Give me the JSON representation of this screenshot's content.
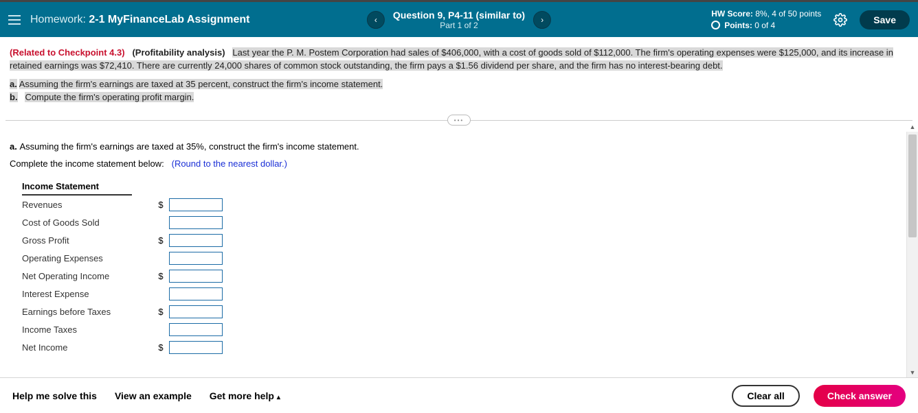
{
  "header": {
    "homework_prefix": "Homework: ",
    "homework_name": "2-1 MyFinanceLab Assignment",
    "question_title": "Question 9, P4-11 (similar to)",
    "question_part": "Part 1 of 2",
    "hw_score_label": "HW Score:",
    "hw_score_value": " 8%, 4 of 50 points",
    "points_label": "Points:",
    "points_value": " 0 of 4",
    "save_label": "Save"
  },
  "problem": {
    "checkpoint": "(Related to Checkpoint 4.3)",
    "topic": "(Profitability analysis)",
    "body1": "Last year the P. M. Postem Corporation had sales of ",
    "sales": "$406,000",
    "body2": ", with a cost of goods sold of ",
    "cogs": "$112,000",
    "body3": ". The firm's operating expenses were ",
    "opex": "$125,000",
    "body4": ", and its increase in retained earnings was ",
    "retained": "$72,410",
    "body5": ". There are currently ",
    "shares": "24,000",
    "body6": " shares of common stock outstanding, the firm pays a ",
    "dividend": "$1.56",
    "body7": " dividend per share, and the firm has no interest-bearing debt.",
    "part_a_prefix": "a.",
    "part_a": "Assuming the firm's earnings are taxed at ",
    "taxrate": "35",
    "part_a_suffix": " percent, construct the firm's income statement.",
    "part_b_prefix": "b.",
    "part_b": "Compute the firm's operating profit margin."
  },
  "work": {
    "subq_prefix": "a.",
    "subq": "Assuming the firm's earnings are taxed at 35%, construct the firm's income statement.",
    "complete_line": "Complete the income statement below:",
    "round_note": "(Round to the nearest dollar.)",
    "table_header": "Income Statement",
    "rows": [
      {
        "label": "Revenues",
        "dollar": "$"
      },
      {
        "label": "Cost of Goods Sold",
        "dollar": ""
      },
      {
        "label": "Gross Profit",
        "dollar": "$"
      },
      {
        "label": "Operating Expenses",
        "dollar": ""
      },
      {
        "label": "Net Operating Income",
        "dollar": "$"
      },
      {
        "label": "Interest Expense",
        "dollar": ""
      },
      {
        "label": "Earnings before Taxes",
        "dollar": "$"
      },
      {
        "label": "Income Taxes",
        "dollar": ""
      },
      {
        "label": "Net Income",
        "dollar": "$"
      }
    ]
  },
  "footer": {
    "help": "Help me solve this",
    "example": "View an example",
    "more": "Get more help",
    "clear": "Clear all",
    "check": "Check answer"
  }
}
